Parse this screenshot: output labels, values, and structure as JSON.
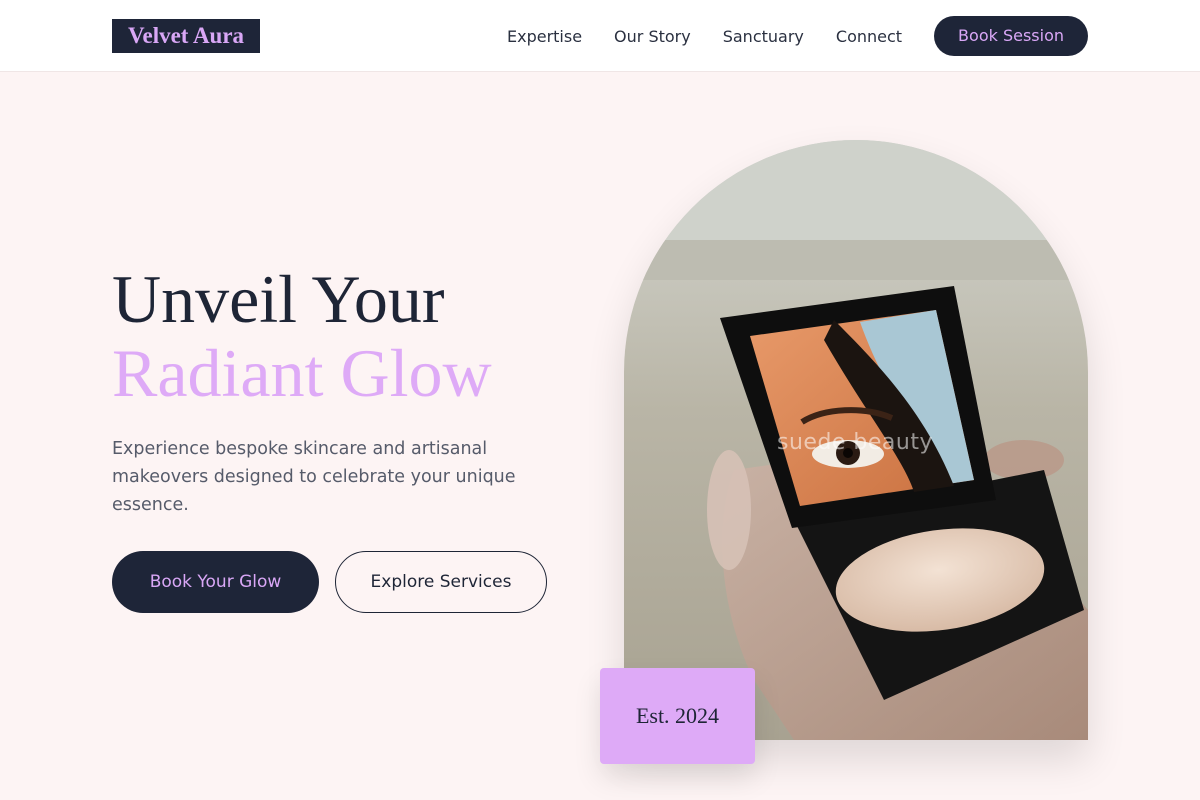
{
  "header": {
    "logo": "Velvet Aura",
    "nav": [
      "Expertise",
      "Our Story",
      "Sanctuary",
      "Connect"
    ],
    "cta": "Book Session"
  },
  "hero": {
    "title_line1": "Unveil Your",
    "title_line2": "Radiant Glow",
    "description": "Experience bespoke skincare and artisanal makeovers designed to celebrate your unique essence.",
    "primary_button": "Book Your Glow",
    "secondary_button": "Explore Services",
    "image_watermark": "suede beauty",
    "badge": "Est. 2024"
  },
  "colors": {
    "navy": "#1e2538",
    "lavender": "#deaaf7",
    "background": "#fdf4f4"
  }
}
